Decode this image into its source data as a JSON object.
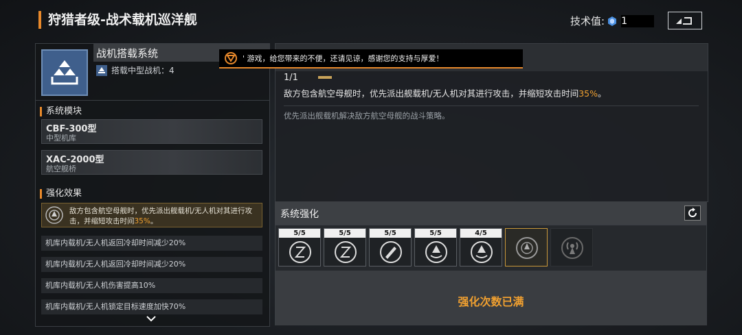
{
  "header": {
    "title": "狩猎者级-战术载机巡洋舰",
    "tech_label": "技术值:",
    "tech_value": "1"
  },
  "system": {
    "name": "战机搭载系统",
    "sub": "搭载中型战机：4"
  },
  "modules_section": "系统模块",
  "modules": [
    {
      "name": "CBF-300型",
      "type": "中型机库"
    },
    {
      "name": "XAC-2000型",
      "type": "航空舰桥"
    }
  ],
  "effects_section": "强化效果",
  "main_effect": {
    "text": "敌方包含航空母舰时，优先派出舰载机/无人机对其进行攻击，并缩短攻击时间",
    "percent": "35%",
    "suffix": "。"
  },
  "buffs": [
    "机库内载机/无人机返回冷却时间减少20%",
    "机库内载机/无人机返回冷却时间减少20%",
    "机库内载机/无人机伤害提高10%",
    "机库内载机/无人机锁定目标速度加快70%"
  ],
  "notice": "' 游戏，给您带来的不便，还请见谅，感谢您的支持与厚爱！",
  "detail": {
    "level": "1/1",
    "desc_pre": "敌方包含航空母舰时，优先派出舰载机/无人机对其进行攻击，并缩短攻击时间",
    "desc_percent": "35%",
    "desc_suffix": "。",
    "flavor": "优先派出舰载机解决敌方航空母舰的战斗策略。"
  },
  "enhance": {
    "title": "系统强化",
    "slots": [
      "5/5",
      "5/5",
      "5/5",
      "5/5",
      "4/5"
    ],
    "maxed_label": "强化次数已满"
  },
  "colors": {
    "accent": "#e8892b",
    "highlight": "#f0a030"
  }
}
